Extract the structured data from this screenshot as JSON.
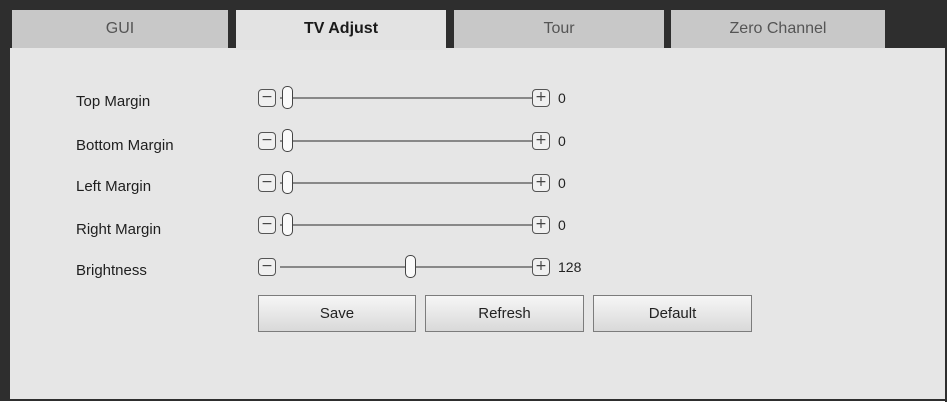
{
  "tabs": [
    {
      "label": "GUI",
      "active": false
    },
    {
      "label": "TV Adjust",
      "active": true
    },
    {
      "label": "Tour",
      "active": false
    },
    {
      "label": "Zero Channel",
      "active": false
    }
  ],
  "settings": [
    {
      "label": "Top Margin",
      "value": "0",
      "fraction": 0.0
    },
    {
      "label": "Bottom Margin",
      "value": "0",
      "fraction": 0.0
    },
    {
      "label": "Left Margin",
      "value": "0",
      "fraction": 0.0
    },
    {
      "label": "Right Margin",
      "value": "0",
      "fraction": 0.0
    },
    {
      "label": "Brightness",
      "value": "128",
      "fraction": 0.5
    }
  ],
  "controls": {
    "minus_symbol": "−",
    "plus_symbol": "+"
  },
  "buttons": {
    "save": "Save",
    "refresh": "Refresh",
    "default": "Default"
  },
  "colors": {
    "border": "#2e2e2e",
    "panel": "#e6e6e6",
    "tab_inactive": "#c8c8c8"
  }
}
